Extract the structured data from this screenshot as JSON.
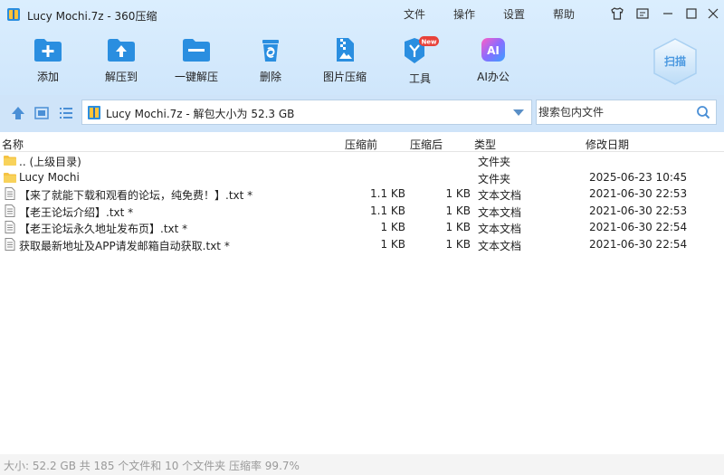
{
  "window": {
    "title": "Lucy Mochi.7z - 360压缩",
    "menus": [
      "文件",
      "操作",
      "设置",
      "帮助"
    ]
  },
  "toolbar": {
    "tools": [
      {
        "label": "添加",
        "icon": "add-folder-icon"
      },
      {
        "label": "解压到",
        "icon": "extract-to-icon"
      },
      {
        "label": "一键解压",
        "icon": "one-click-extract-icon"
      },
      {
        "label": "删除",
        "icon": "trash-icon"
      },
      {
        "label": "图片压缩",
        "icon": "image-compress-icon"
      },
      {
        "label": "工具",
        "icon": "tools-icon",
        "badge": "New"
      },
      {
        "label": "AI办公",
        "icon": "ai-office-icon",
        "badge_text": "AI"
      }
    ],
    "scan_label": "扫描"
  },
  "pathbar": {
    "path": "Lucy Mochi.7z - 解包大小为 52.3 GB",
    "search_placeholder": "搜索包内文件"
  },
  "list": {
    "headers": {
      "name": "名称",
      "compressed": "压缩前",
      "size": "压缩后",
      "type": "类型",
      "modified": "修改日期"
    },
    "rows": [
      {
        "name": ".. (上级目录)",
        "compressed": "",
        "size": "",
        "type": "文件夹",
        "modified": "",
        "icon": "folder-icon"
      },
      {
        "name": "Lucy Mochi",
        "compressed": "",
        "size": "",
        "type": "文件夹",
        "modified": "2025-06-23 10:45",
        "icon": "folder-icon"
      },
      {
        "name": "【来了就能下载和观看的论坛，纯免费！】.txt *",
        "compressed": "1.1 KB",
        "size": "1 KB",
        "type": "文本文档",
        "modified": "2021-06-30 22:53",
        "icon": "text-file-icon"
      },
      {
        "name": "【老王论坛介绍】.txt *",
        "compressed": "1.1 KB",
        "size": "1 KB",
        "type": "文本文档",
        "modified": "2021-06-30 22:53",
        "icon": "text-file-icon"
      },
      {
        "name": "【老王论坛永久地址发布页】.txt *",
        "compressed": "1 KB",
        "size": "1 KB",
        "type": "文本文档",
        "modified": "2021-06-30 22:54",
        "icon": "text-file-icon"
      },
      {
        "name": "获取最新地址及APP请发邮箱自动获取.txt *",
        "compressed": "1 KB",
        "size": "1 KB",
        "type": "文本文档",
        "modified": "2021-06-30 22:54",
        "icon": "text-file-icon"
      }
    ]
  },
  "status": {
    "text": "大小: 52.2 GB 共 185 个文件和 10 个文件夹 压缩率 99.7%"
  },
  "colors": {
    "accent": "#2a8ee0",
    "toolbar_bg": "#d6ebfd",
    "folder": "#f5c343",
    "new_badge": "#e8423a"
  }
}
